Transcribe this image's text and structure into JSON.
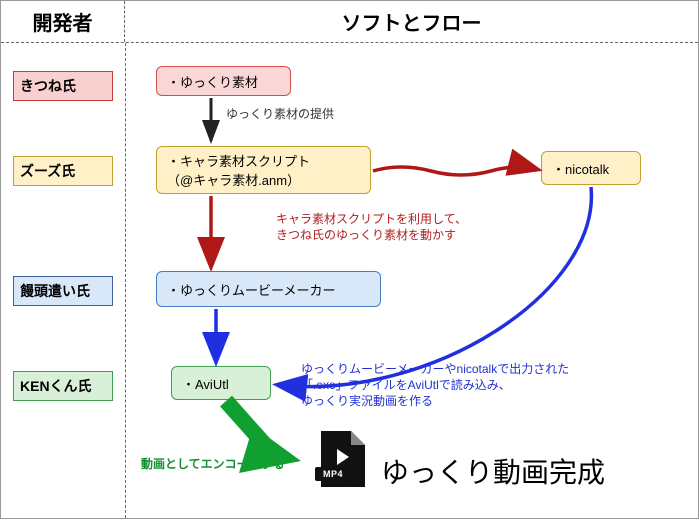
{
  "header": {
    "left": "開発者",
    "right": "ソフトとフロー"
  },
  "developers": {
    "kitsune": "きつね氏",
    "zuzu": "ズーズ氏",
    "manju": "饅頭遣い氏",
    "ken": "KENくん氏"
  },
  "nodes": {
    "yukkuri_material": "・ゆっくり素材",
    "chara_script_l1": "・キャラ素材スクリプト",
    "chara_script_l2": "（@キャラ素材.anm）",
    "nicotalk": "・nicotalk",
    "ymm": "・ゆっくりムービーメーカー",
    "aviutl": "・AviUtl"
  },
  "annotations": {
    "provide": "ゆっくり素材の提供",
    "script_use_l1": "キャラ素材スクリプトを利用して、",
    "script_use_l2": "きつね氏のゆっくり素材を動かす",
    "aviutl_l1": "ゆっくりムービーメーカーやnicotalkで出力された",
    "aviutl_l2": "「.exo」ファイルをAviUtlで読み込み、",
    "aviutl_l3": "ゆっくり実況動画を作る",
    "encode": "動画としてエンコードする"
  },
  "final": {
    "label": "ゆっくり動画完成",
    "format": "MP4"
  },
  "colors": {
    "arrow_black": "#222222",
    "arrow_red": "#b01818",
    "arrow_blue": "#2030e0",
    "arrow_green": "#10a030"
  }
}
